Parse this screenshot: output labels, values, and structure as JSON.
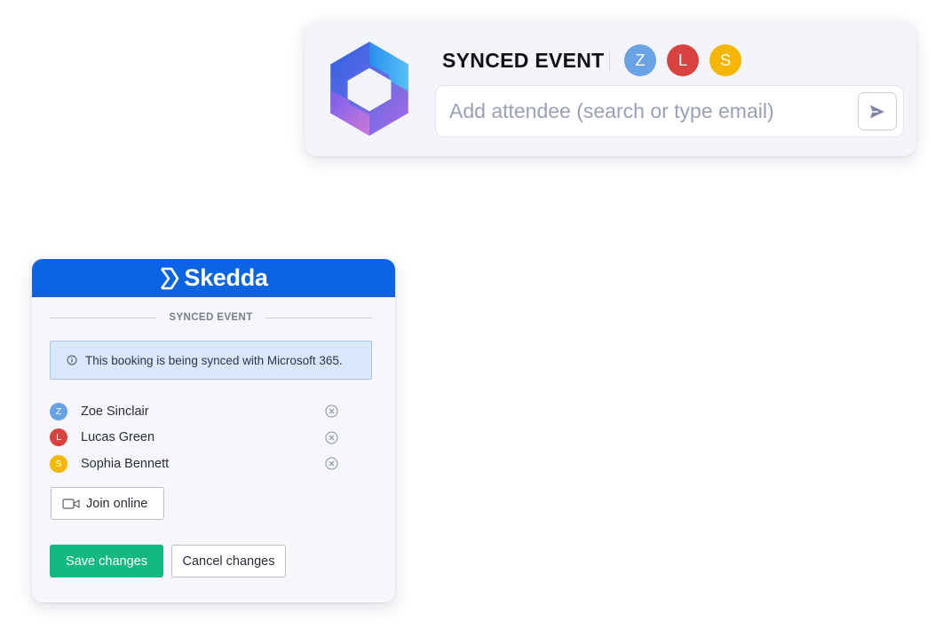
{
  "ms_card": {
    "title": "SYNCED EVENT",
    "avatars": [
      {
        "initial": "Z",
        "color": "#6aa2e6"
      },
      {
        "initial": "L",
        "color": "#d8423f"
      },
      {
        "initial": "S",
        "color": "#f6b700"
      }
    ],
    "input_placeholder": "Add attendee (search or type email)",
    "logo_icon": "microsoft-365-logo-icon",
    "send_icon": "send-icon"
  },
  "skedda": {
    "brand": "Skedda",
    "section_label": "SYNCED EVENT",
    "info_message": "This booking is being synced with Microsoft 365.",
    "attendees": [
      {
        "initial": "Z",
        "name": "Zoe Sinclair",
        "color": "#6aa2e6"
      },
      {
        "initial": "L",
        "name": "Lucas Green",
        "color": "#d8423f"
      },
      {
        "initial": "S",
        "name": "Sophia Bennett",
        "color": "#f6b700"
      }
    ],
    "join_label": "Join online",
    "save_label": "Save changes",
    "cancel_label": "Cancel changes",
    "colors": {
      "header": "#0a63e3",
      "save": "#13b97f"
    }
  }
}
